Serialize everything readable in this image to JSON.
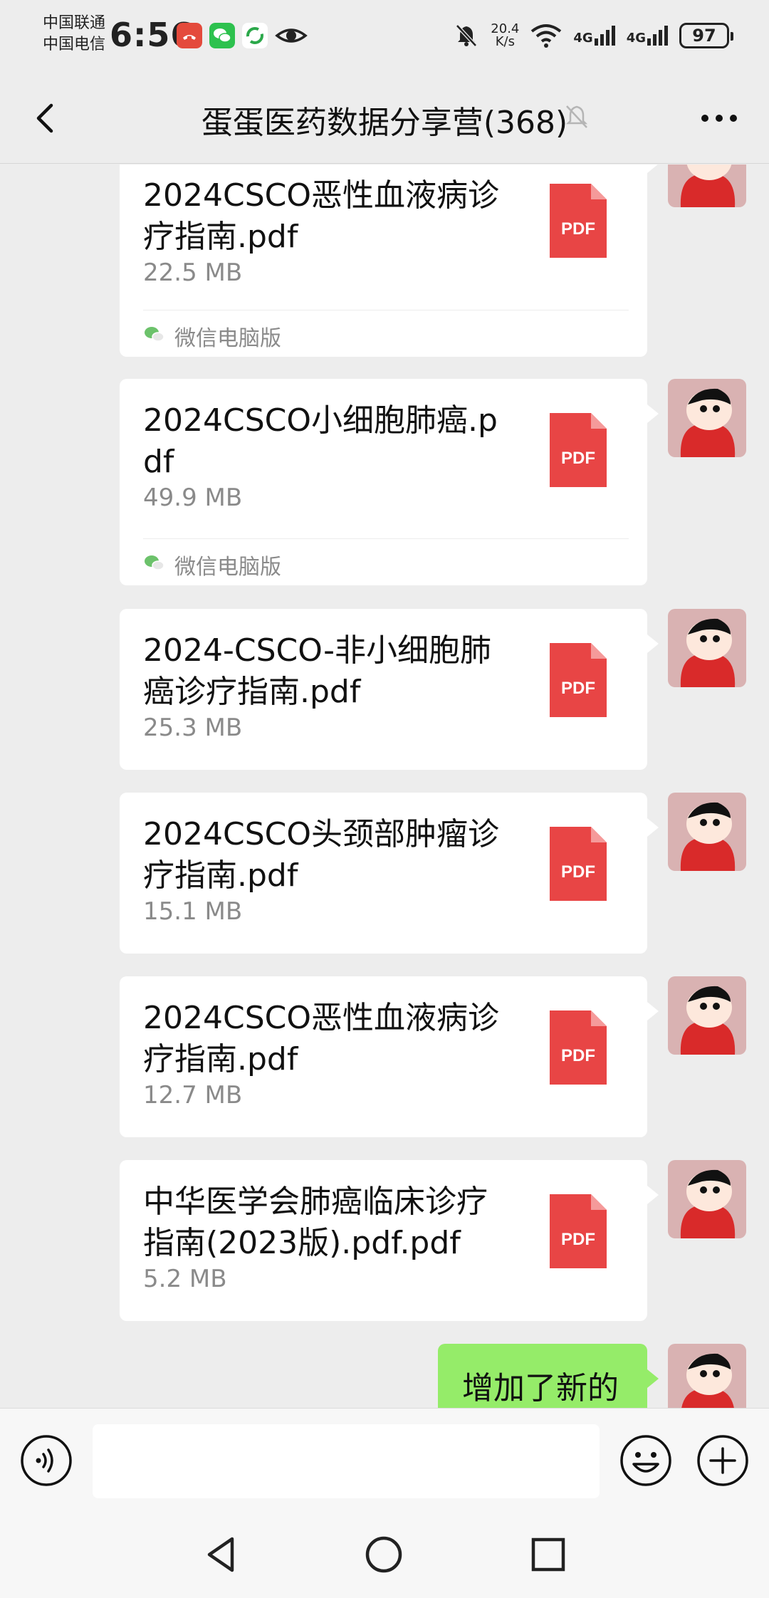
{
  "status_bar": {
    "carrier_1": "中国联通",
    "carrier_2": "中国电信",
    "time": "6:56",
    "net_speed_value": "20.4",
    "net_speed_unit": "K/s",
    "signal_1": "4G",
    "signal_2": "4G",
    "battery": "97"
  },
  "header": {
    "title": "蛋蛋医药数据分享营(368)"
  },
  "messages": [
    {
      "file_name": "2024CSCO恶性血液病诊疗指南.pdf",
      "file_size": "22.5 MB",
      "file_type": "PDF",
      "source": "微信电脑版"
    },
    {
      "file_name": "2024CSCO小细胞肺癌.pdf",
      "file_size": "49.9 MB",
      "file_type": "PDF",
      "source": "微信电脑版"
    },
    {
      "file_name": "2024-CSCO-非小细胞肺癌诊疗指南.pdf",
      "file_size": "25.3 MB",
      "file_type": "PDF"
    },
    {
      "file_name": "2024CSCO头颈部肿瘤诊疗指南.pdf",
      "file_size": "15.1 MB",
      "file_type": "PDF"
    },
    {
      "file_name": "2024CSCO恶性血液病诊疗指南.pdf",
      "file_size": "12.7 MB",
      "file_type": "PDF"
    },
    {
      "file_name": "中华医学会肺癌临床诊疗指南(2023版).pdf.pdf",
      "file_size": "5.2 MB",
      "file_type": "PDF"
    }
  ],
  "last_text_message": "增加了新的",
  "input": {
    "value": "",
    "placeholder": ""
  },
  "colors": {
    "background": "#ededed",
    "pdf_red": "#e84545",
    "own_bubble": "#95ec69",
    "avatar_red": "#d92a2a"
  },
  "icons": [
    "back-icon",
    "mute-bell-icon",
    "more-icon",
    "pdf-file-icon",
    "wechat-icon",
    "voice-icon",
    "emoji-icon",
    "plus-icon",
    "nav-back-icon",
    "nav-home-icon",
    "nav-recents-icon"
  ]
}
